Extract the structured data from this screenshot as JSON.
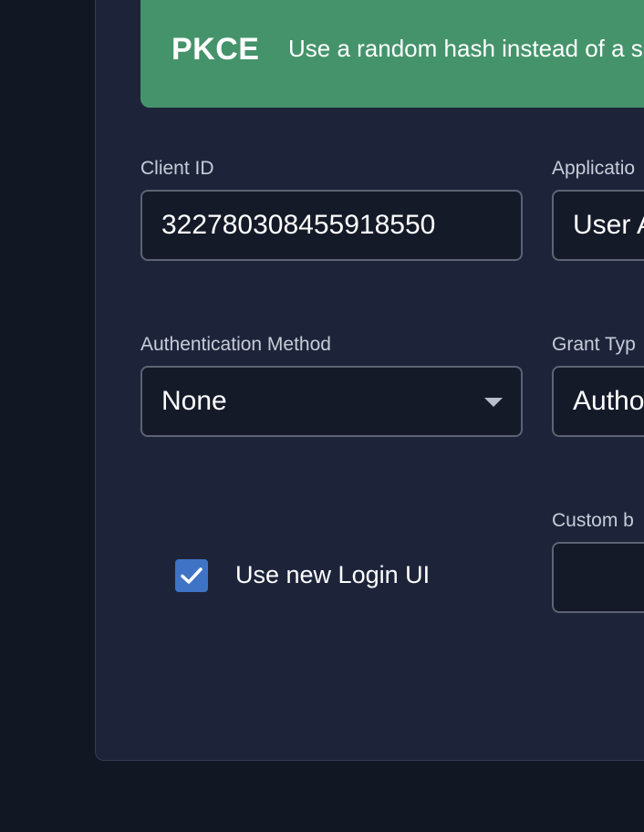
{
  "banner": {
    "title": "PKCE",
    "description": "Use a random hash instead of a s"
  },
  "fields": {
    "client_id": {
      "label": "Client ID",
      "value": "322780308455918550"
    },
    "application_type": {
      "label": "Applicatio",
      "value": "User A"
    },
    "auth_method": {
      "label": "Authentication Method",
      "value": "None"
    },
    "grant_type": {
      "label": "Grant Typ",
      "value": "Autho"
    },
    "custom_base": {
      "label": "Custom b",
      "value": ""
    }
  },
  "login_ui": {
    "label": "Use new Login UI",
    "checked": true
  },
  "colors": {
    "background": "#121724",
    "panel": "#1d243a",
    "banner": "#45936b",
    "checkbox": "#3e73c5"
  }
}
